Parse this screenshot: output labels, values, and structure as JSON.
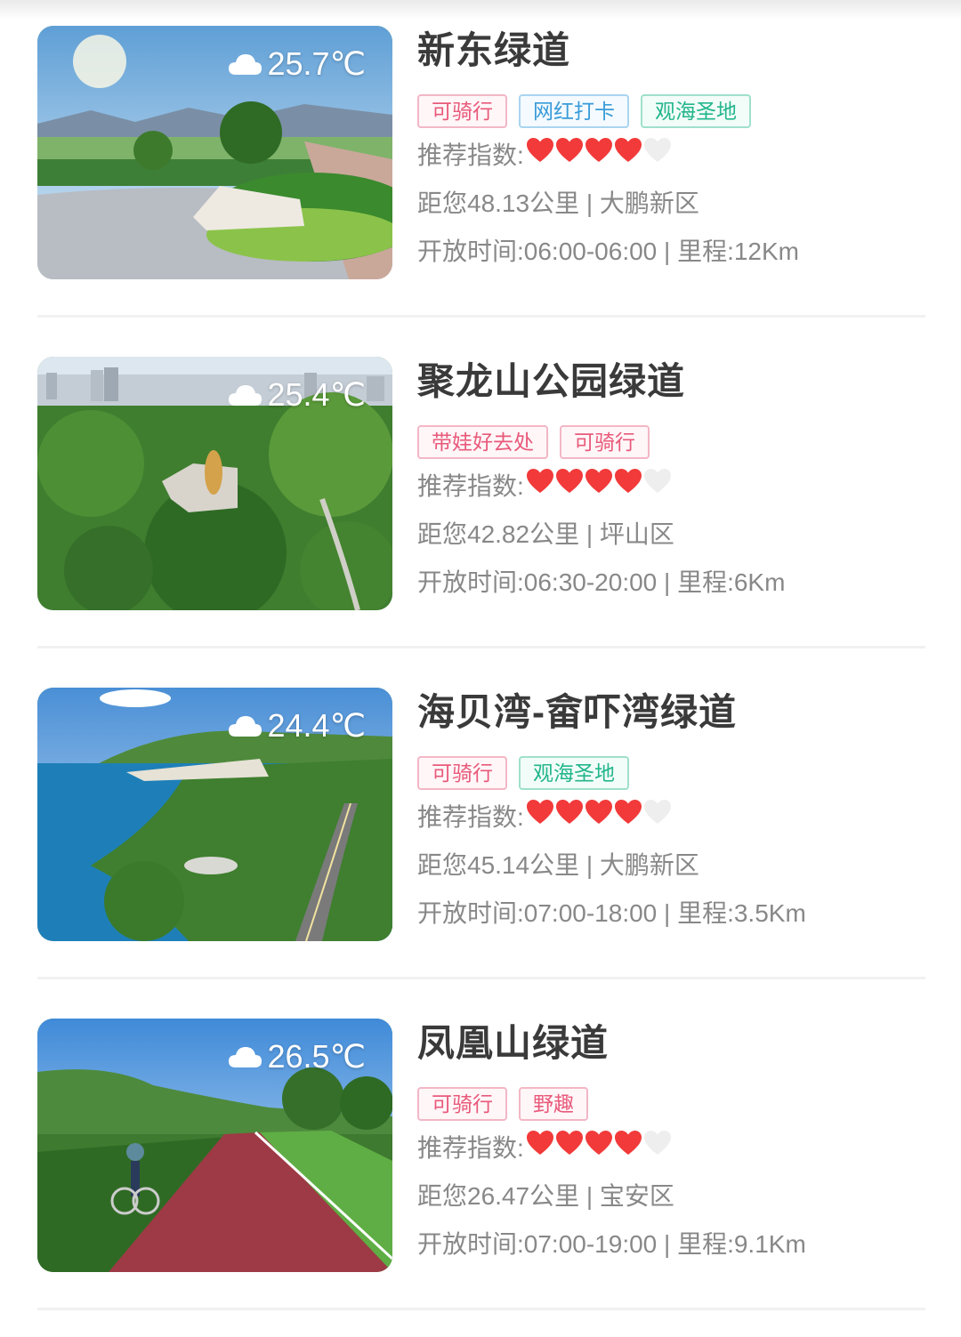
{
  "cards": [
    {
      "title": "新东绿道",
      "temperature": "25.7℃",
      "weather_icon": "cloud-icon",
      "tags": [
        {
          "text": "可骑行",
          "color": "pink"
        },
        {
          "text": "网红打卡",
          "color": "blue"
        },
        {
          "text": "观海圣地",
          "color": "green"
        }
      ],
      "rating_label": "推荐指数:",
      "rating": 4,
      "rating_max": 5,
      "distance": "距您48.13公里 | 大鹏新区",
      "hours": "开放时间:06:00-06:00 | 里程:12Km",
      "scene": "park"
    },
    {
      "title": "聚龙山公园绿道",
      "temperature": "25.4℃",
      "weather_icon": "cloud-icon",
      "tags": [
        {
          "text": "带娃好去处",
          "color": "pink"
        },
        {
          "text": "可骑行",
          "color": "pink"
        }
      ],
      "rating_label": "推荐指数:",
      "rating": 4,
      "rating_max": 5,
      "distance": "距您42.82公里 | 坪山区",
      "hours": "开放时间:06:30-20:00 | 里程:6Km",
      "scene": "forest"
    },
    {
      "title": "海贝湾-畲吓湾绿道",
      "temperature": "24.4℃",
      "weather_icon": "cloud-icon",
      "tags": [
        {
          "text": "可骑行",
          "color": "pink"
        },
        {
          "text": "观海圣地",
          "color": "green"
        }
      ],
      "rating_label": "推荐指数:",
      "rating": 4,
      "rating_max": 5,
      "distance": "距您45.14公里 | 大鹏新区",
      "hours": "开放时间:07:00-18:00 | 里程:3.5Km",
      "scene": "coast"
    },
    {
      "title": "凤凰山绿道",
      "temperature": "26.5℃",
      "weather_icon": "cloud-icon",
      "tags": [
        {
          "text": "可骑行",
          "color": "pink"
        },
        {
          "text": "野趣",
          "color": "pink"
        }
      ],
      "rating_label": "推荐指数:",
      "rating": 4,
      "rating_max": 5,
      "distance": "距您26.47公里 | 宝安区",
      "hours": "开放时间:07:00-19:00 | 里程:9.1Km",
      "scene": "bikepath"
    }
  ],
  "colors": {
    "heart_on": "#f23a3a",
    "heart_off": "#eeeeee"
  }
}
